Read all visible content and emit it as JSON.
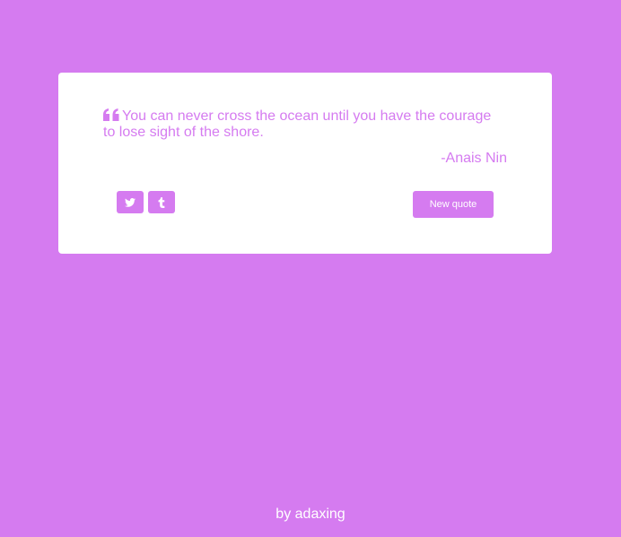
{
  "colors": {
    "accent": "#d57bf0",
    "card": "#ffffff",
    "text_on_accent": "#ffffff"
  },
  "quote": {
    "icon": "quote-left-icon",
    "text": "You can never cross the ocean until you have the courage to lose sight of the shore.",
    "author": "-Anais Nin"
  },
  "actions": {
    "twitter_icon": "twitter-icon",
    "tumblr_icon": "tumblr-icon",
    "new_quote_label": "New quote"
  },
  "footer": {
    "credit": "by adaxing"
  }
}
